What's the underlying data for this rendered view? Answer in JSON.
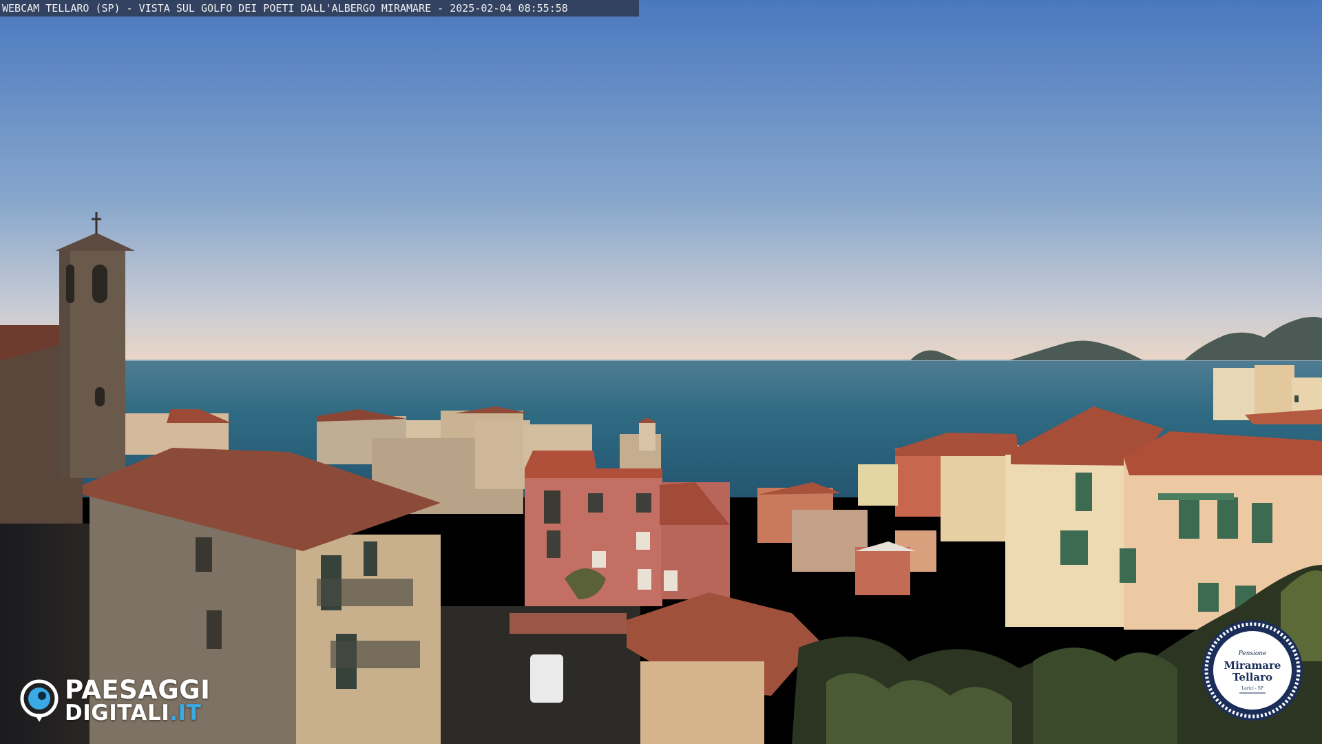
{
  "caption": {
    "text": "WEBCAM TELLARO (SP) - VISTA SUL GOLFO DEI POETI DALL'ALBERGO MIRAMARE - 2025-02-04 08:55:58"
  },
  "brand_logo": {
    "line1": "PAESAGGI",
    "line2_main": "DIGITALI",
    "line2_tld": ".IT",
    "icon": "eye-icon",
    "accent_color": "#3ba9e6"
  },
  "hotel_badge": {
    "small": "Pensione",
    "name_line1": "Miramare",
    "name_line2": "Tellaro",
    "tiny": "Lerici - SP",
    "ring_color": "#1b2e5a"
  },
  "colors": {
    "sky_top": "#4f7cc0",
    "sky_horizon": "#e9d7c8",
    "sea": "#2c6680",
    "roof": "#b4553d"
  }
}
